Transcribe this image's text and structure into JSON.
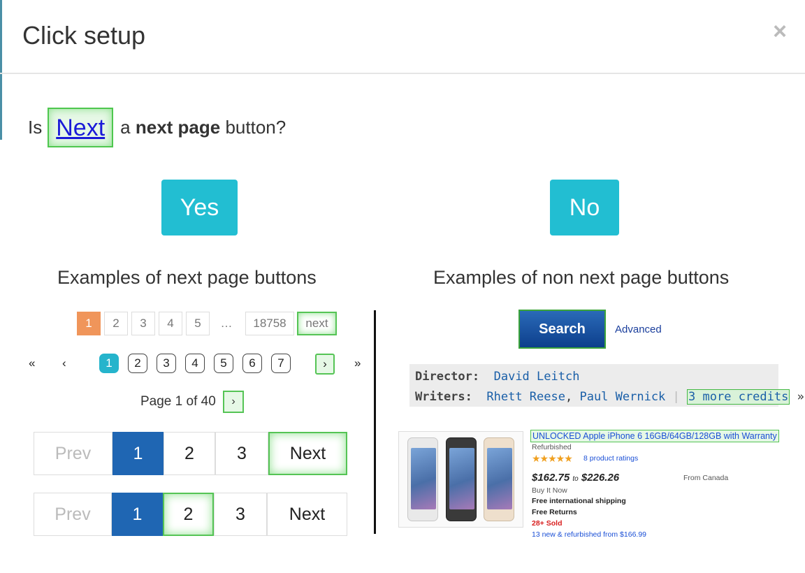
{
  "modal": {
    "title": "Click setup",
    "close_label": "×"
  },
  "question": {
    "prefix": "Is",
    "highlight": "Next",
    "middle": "a",
    "bold": "next page",
    "suffix": "button?"
  },
  "answers": {
    "yes": "Yes",
    "no": "No"
  },
  "columns": {
    "left_title": "Examples of next page buttons",
    "right_title": "Examples of non next page buttons"
  },
  "example1": {
    "pages": [
      "1",
      "2",
      "3",
      "4",
      "5"
    ],
    "ellipsis": "…",
    "last": "18758",
    "next": "next",
    "active": "1"
  },
  "example2": {
    "first": "«",
    "prev": "‹",
    "pages": [
      "1",
      "2",
      "3",
      "4",
      "5",
      "6",
      "7"
    ],
    "next": "›",
    "last": "»",
    "active": "1"
  },
  "example3": {
    "text": "Page 1 of 40",
    "next": "›"
  },
  "example4": {
    "prev": "Prev",
    "pages": [
      "1",
      "2",
      "3"
    ],
    "next": "Next",
    "active": "1",
    "highlighted": "Next"
  },
  "example5": {
    "prev": "Prev",
    "pages": [
      "1",
      "2",
      "3"
    ],
    "next": "Next",
    "active": "1",
    "highlighted": "2"
  },
  "non_examples": {
    "search": {
      "button": "Search",
      "advanced": "Advanced"
    },
    "credits": {
      "director_label": "Director:",
      "director": "David Leitch",
      "writers_label": "Writers:",
      "writer1": "Rhett Reese",
      "comma": ",",
      "writer2": "Paul Wernick",
      "sep": "|",
      "more": "3 more credits",
      "more_arrow": "»"
    },
    "product": {
      "title": "UNLOCKED Apple iPhone 6 16GB/64GB/128GB with Warranty",
      "condition": "Refurbished",
      "stars": "★★★★★",
      "ratings": "8 product ratings",
      "price_low": "$162.75",
      "price_to": "to",
      "price_high": "$226.26",
      "origin": "From Canada",
      "buy_type": "Buy It Now",
      "shipping": "Free international shipping",
      "returns": "Free Returns",
      "sold": "28+ Sold",
      "refurb_link": "13 new & refurbished from $166.99"
    }
  },
  "colors": {
    "accent": "#22bed2",
    "highlight_green": "#55c455",
    "active_blue": "#1f66b3",
    "active_orange": "#f0955a"
  }
}
